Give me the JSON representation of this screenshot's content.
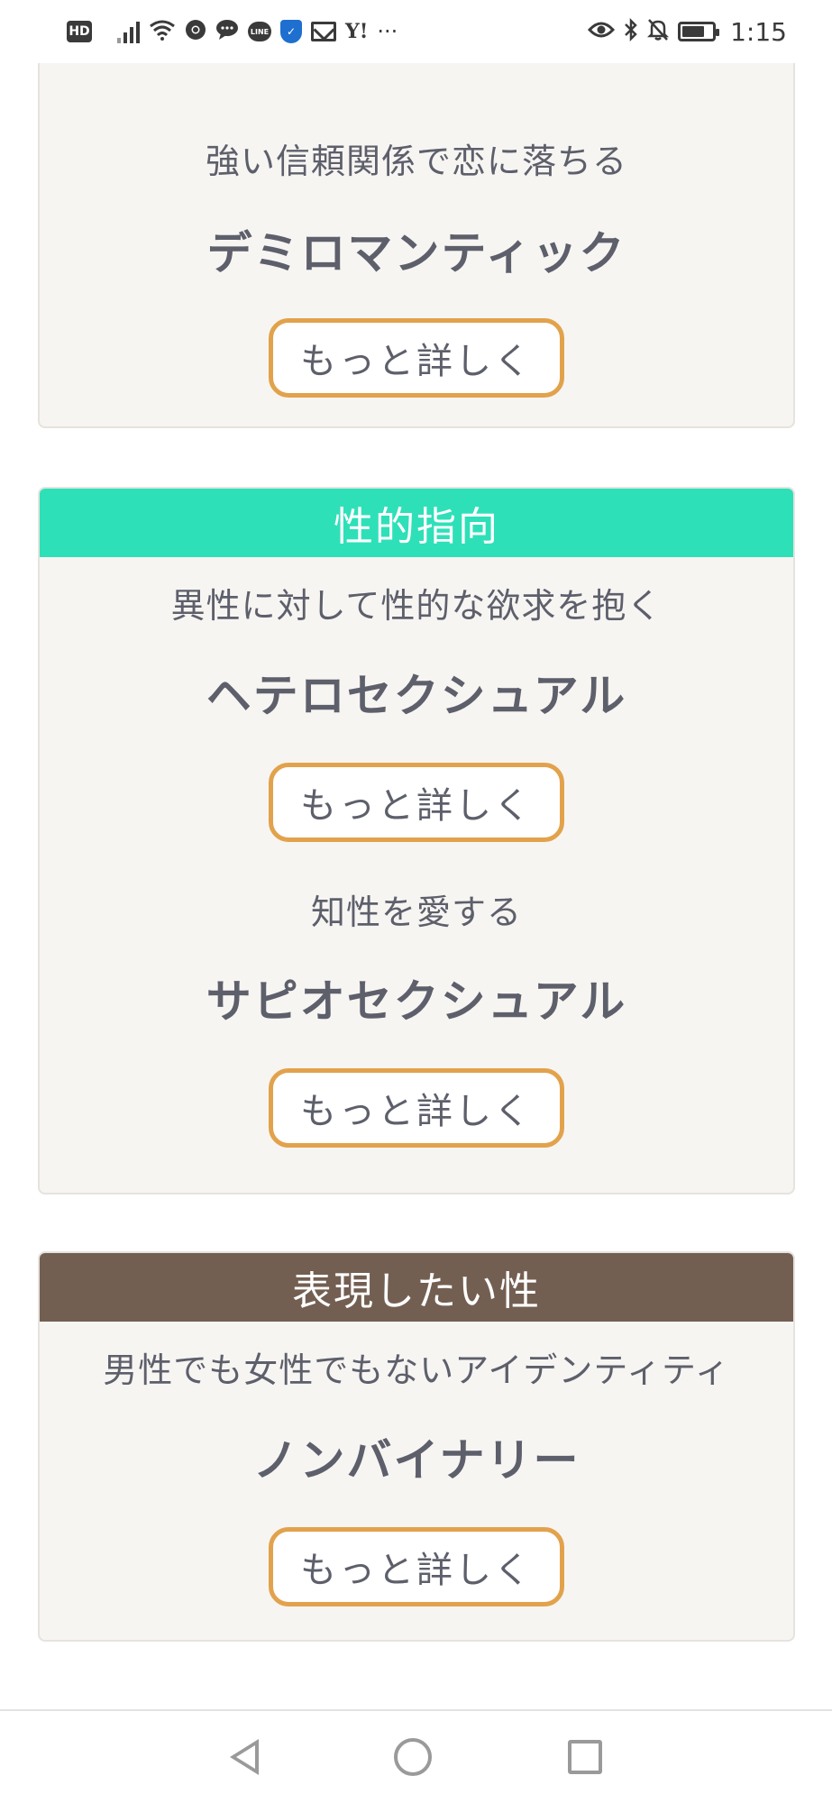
{
  "status_bar": {
    "hd": "HD",
    "line": "LINE",
    "yahoo": "Y!",
    "more": "···",
    "time": "1:15",
    "battery_level": 0.75,
    "icons": [
      "hd-icon",
      "signal-icon",
      "wifi-icon",
      "chrome-icon",
      "chat-icon",
      "line-icon",
      "shield-icon",
      "mail-icon",
      "yahoo-icon",
      "overflow-icon",
      "eye-icon",
      "bluetooth-icon",
      "mute-icon",
      "battery-icon"
    ]
  },
  "cards": {
    "romantic": {
      "description": "強い信頼関係で恋に落ちる",
      "name": "デミロマンティック",
      "button": "もっと詳しく"
    },
    "sexual": {
      "title": "性的指向",
      "header_color": "#2ee0b8",
      "items": [
        {
          "description": "異性に対して性的な欲求を抱く",
          "name": "ヘテロセクシュアル",
          "button": "もっと詳しく"
        },
        {
          "description": "知性を愛する",
          "name": "サピオセクシュアル",
          "button": "もっと詳しく"
        }
      ]
    },
    "expression": {
      "title": "表現したい性",
      "header_color": "#735f52",
      "items": [
        {
          "description": "男性でも女性でもないアイデンティティ",
          "name": "ノンバイナリー",
          "button": "もっと詳しく"
        }
      ]
    }
  },
  "colors": {
    "button_border": "#e2a24c",
    "card_bg": "#f7f5f2",
    "text": "#5d5f6b"
  },
  "nav_bar": {
    "icons": [
      "back-icon",
      "home-icon",
      "recents-icon"
    ]
  }
}
